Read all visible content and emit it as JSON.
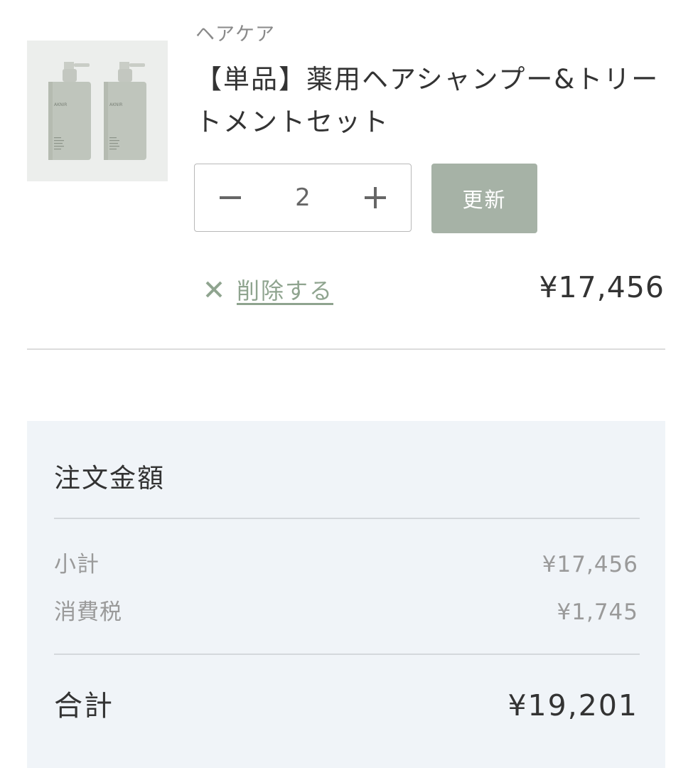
{
  "item": {
    "category": "ヘアケア",
    "name": "【単品】薬用ヘアシャンプー&トリートメントセット",
    "image_alt": "AKNIR",
    "quantity": "2",
    "update_label": "更新",
    "remove_label": "削除する",
    "price": "¥17,456"
  },
  "summary": {
    "title": "注文金額",
    "subtotal_label": "小計",
    "subtotal_value": "¥17,456",
    "tax_label": "消費税",
    "tax_value": "¥1,745",
    "total_label": "合計",
    "total_value": "¥19,201"
  },
  "colors": {
    "accent": "#a6b2a6",
    "link": "#8fa48f",
    "summary_bg": "#f0f4f8"
  },
  "icons": {
    "minus": "minus-icon",
    "plus": "plus-icon",
    "remove": "close-icon"
  }
}
